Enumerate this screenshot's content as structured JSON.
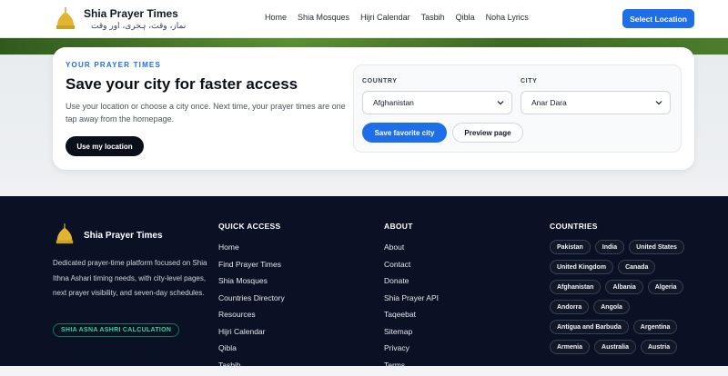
{
  "header": {
    "brand_title": "Shia Prayer Times",
    "brand_tagline": "نماز، وقت، ہجری، اور وقت",
    "nav": [
      "Home",
      "Shia Mosques",
      "Hijri Calendar",
      "Tasbih",
      "Qibla",
      "Noha Lyrics"
    ],
    "select_location_label": "Select Location"
  },
  "card": {
    "eyebrow": "YOUR PRAYER TIMES",
    "title": "Save your city for faster access",
    "description": "Use your location or choose a city once. Next time, your prayer times are one tap away from the homepage.",
    "use_location_label": "Use my location",
    "country_label": "COUNTRY",
    "country_value": "Afghanistan",
    "city_label": "CITY",
    "city_value": "Anar Dara",
    "save_label": "Save favorite city",
    "preview_label": "Preview page"
  },
  "footer": {
    "brand_title": "Shia Prayer Times",
    "description": "Dedicated prayer-time platform focused on Shia Ithna Ashari timing needs, with city-level pages, next prayer visibility, and seven-day schedules.",
    "badge": "SHIA ASNA ASHRI CALCULATION",
    "quick_access": {
      "heading": "QUICK ACCESS",
      "links": [
        "Home",
        "Find Prayer Times",
        "Shia Mosques",
        "Countries Directory",
        "Resources",
        "Hijri Calendar",
        "Qibla",
        "Tasbih"
      ]
    },
    "about": {
      "heading": "ABOUT",
      "links": [
        "About",
        "Contact",
        "Donate",
        "Shia Prayer API",
        "Taqeebat",
        "Sitemap",
        "Privacy",
        "Terms"
      ]
    },
    "countries": {
      "heading": "COUNTRIES",
      "chips": [
        "Pakistan",
        "India",
        "United States",
        "United Kingdom",
        "Canada",
        "Afghanistan",
        "Albania",
        "Algeria",
        "Andorra",
        "Angola",
        "Antigua and Barbuda",
        "Argentina",
        "Armenia",
        "Australia",
        "Austria"
      ]
    }
  },
  "colors": {
    "accent": "#1d6ee8",
    "footer_bg": "#0a1124",
    "badge_green": "#34d399"
  },
  "icons": {
    "logo": "mosque-dome-icon",
    "select": "chevron-down-icon"
  }
}
